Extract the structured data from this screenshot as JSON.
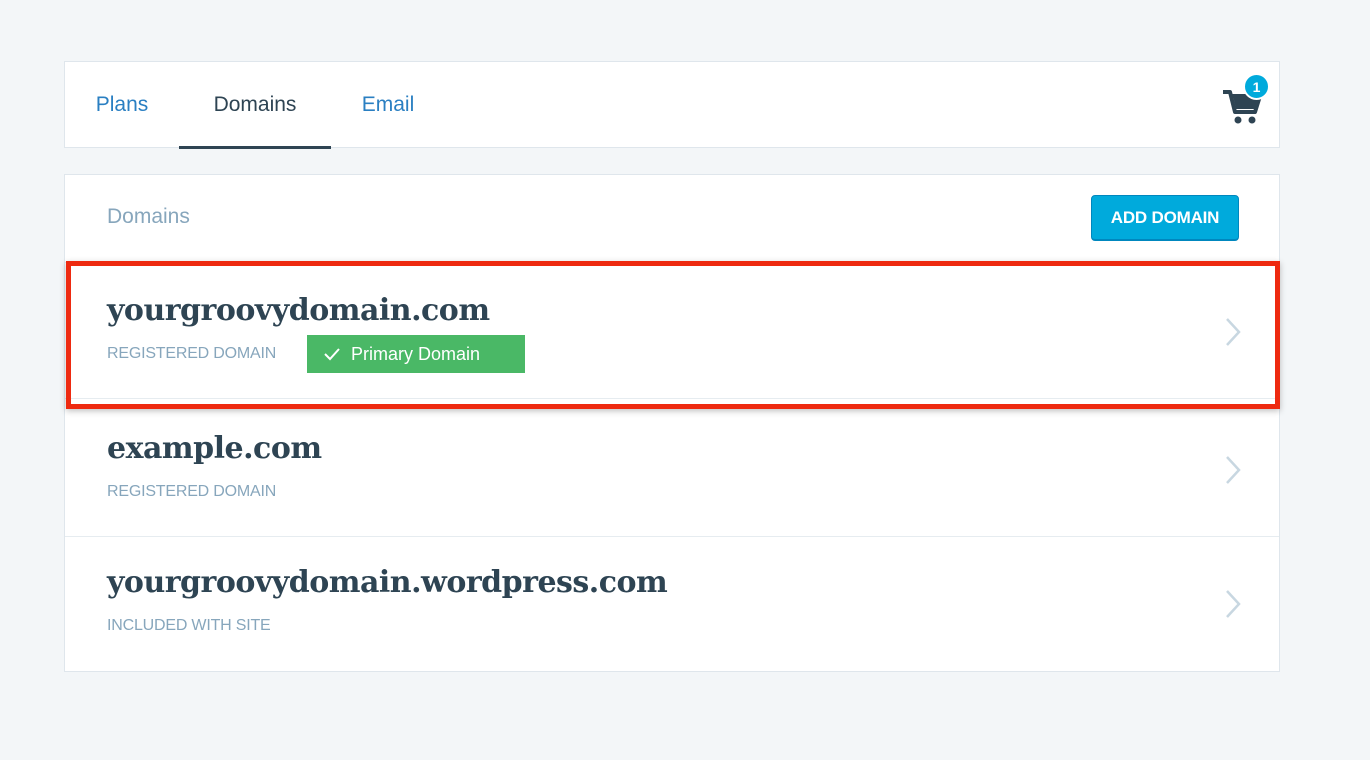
{
  "tabs": {
    "plans": "Plans",
    "domains": "Domains",
    "email": "Email"
  },
  "cart": {
    "count": "1"
  },
  "card": {
    "title": "Domains",
    "add_button": "ADD DOMAIN"
  },
  "domains": [
    {
      "name": "yourgroovydomain.com",
      "type": "REGISTERED DOMAIN",
      "badge": "Primary Domain"
    },
    {
      "name": "example.com",
      "type": "REGISTERED DOMAIN"
    },
    {
      "name": "yourgroovydomain.wordpress.com",
      "type": "INCLUDED WITH SITE"
    }
  ],
  "colors": {
    "accent": "#00aadc",
    "link": "#2a7fc2",
    "primary_badge": "#4ab866",
    "highlight": "#ee2a10",
    "text_dark": "#2e4453",
    "text_muted": "#87a6bc"
  }
}
